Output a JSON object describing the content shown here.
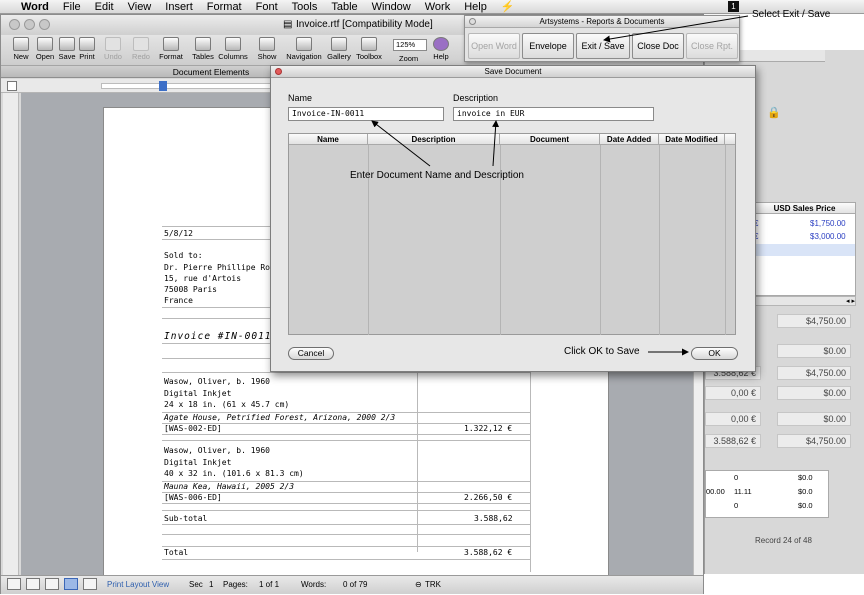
{
  "menubar": {
    "apple": "",
    "app": "Word",
    "items": [
      "File",
      "Edit",
      "View",
      "Insert",
      "Format",
      "Font",
      "Tools",
      "Table",
      "Window",
      "Work",
      "Help"
    ],
    "script_menu": "⚡",
    "right_icon": "1"
  },
  "window": {
    "title": "Invoice.rtf [Compatibility Mode]"
  },
  "toolbar": {
    "items": [
      "New",
      "Open",
      "Save",
      "Print",
      "Undo",
      "Redo",
      "Format",
      "Tables",
      "Columns",
      "Show",
      "Navigation",
      "Gallery",
      "Toolbox",
      "Zoom",
      "Help"
    ],
    "zoom_value": "125%"
  },
  "ribbon": {
    "tab": "Document Elements"
  },
  "document": {
    "date": "5/8/12",
    "sold_to_label": "Sold to:",
    "buyer": [
      "Dr. Pierre Phillipe Rober",
      "15, rue d'Artois",
      "75008 Paris",
      "France"
    ],
    "invoice_title": "Invoice #IN-0011",
    "items": [
      {
        "artist": "Wasow, Oliver, b. 1960",
        "medium": "Digital Inkjet",
        "size": "24 x 18 in. (61 x 45.7 cm)",
        "title": "Agate House, Petrified Forest, Arizona, 2000 2/3",
        "code": "[WAS-002-ED]",
        "price": "1.322,12 €"
      },
      {
        "artist": "Wasow, Oliver, b. 1960",
        "medium": "Digital Inkjet",
        "size": "40 x 32 in. (101.6 x 81.3 cm)",
        "title": "Mauna Kea, Hawaii, 2005 2/3",
        "code": "[WAS-006-ED]",
        "price": "2.266,50 €"
      }
    ],
    "subtotal_label": "Sub-total",
    "subtotal_value": "3.588,62",
    "total_label": "Total",
    "total_value": "3.588,62 €"
  },
  "statusbar": {
    "view": "Print Layout View",
    "sec_label": "Sec",
    "sec_value": "1",
    "pages_label": "Pages:",
    "pages_value": "1 of 1",
    "words_label": "Words:",
    "words_value": "0 of 79",
    "trk": "TRK"
  },
  "palette": {
    "title": "Artsystems - Reports & Documents",
    "buttons": [
      "Open Word",
      "Envelope",
      "Exit / Save",
      "Close Doc",
      "Close Rpt."
    ]
  },
  "dialog": {
    "title": "Save Document",
    "name_label": "Name",
    "name_value": "Invoice-IN-0011",
    "desc_label": "Description",
    "desc_value": "invoice in EUR",
    "columns": [
      "Name",
      "Description",
      "Document",
      "Date Added",
      "Date Modified"
    ],
    "cancel": "Cancel",
    "ok": "OK"
  },
  "annotations": {
    "exit_save": "Select Exit / Save",
    "name_desc": "Enter Document Name and Description",
    "ok": "Click OK to Save"
  },
  "db": {
    "col_header": "USD Sales Price",
    "list": [
      {
        "eur": "€",
        "usd": "$1,750.00"
      },
      {
        "eur": "€",
        "usd": "$3,000.00"
      }
    ],
    "fields": [
      {
        "left": "€",
        "right": "$4,750.00"
      },
      {
        "left": "€",
        "right": "$0.00"
      },
      {
        "left": "3.588,62 €",
        "right": "$4,750.00"
      },
      {
        "left": "0,00 €",
        "right": "$0.00"
      },
      {
        "left": "0,00 €",
        "right": "$0.00"
      },
      {
        "left": "3.588,62 €",
        "right": "$4,750.00"
      }
    ],
    "lower_rows": [
      {
        "a": "0",
        "b": "",
        "c": "$0.0"
      },
      {
        "a": "00.00",
        "b": "11.11",
        "c": "$0.0"
      },
      {
        "a": "0",
        "b": "",
        "c": "$0.0"
      }
    ],
    "record": "Record 24 of 48"
  }
}
